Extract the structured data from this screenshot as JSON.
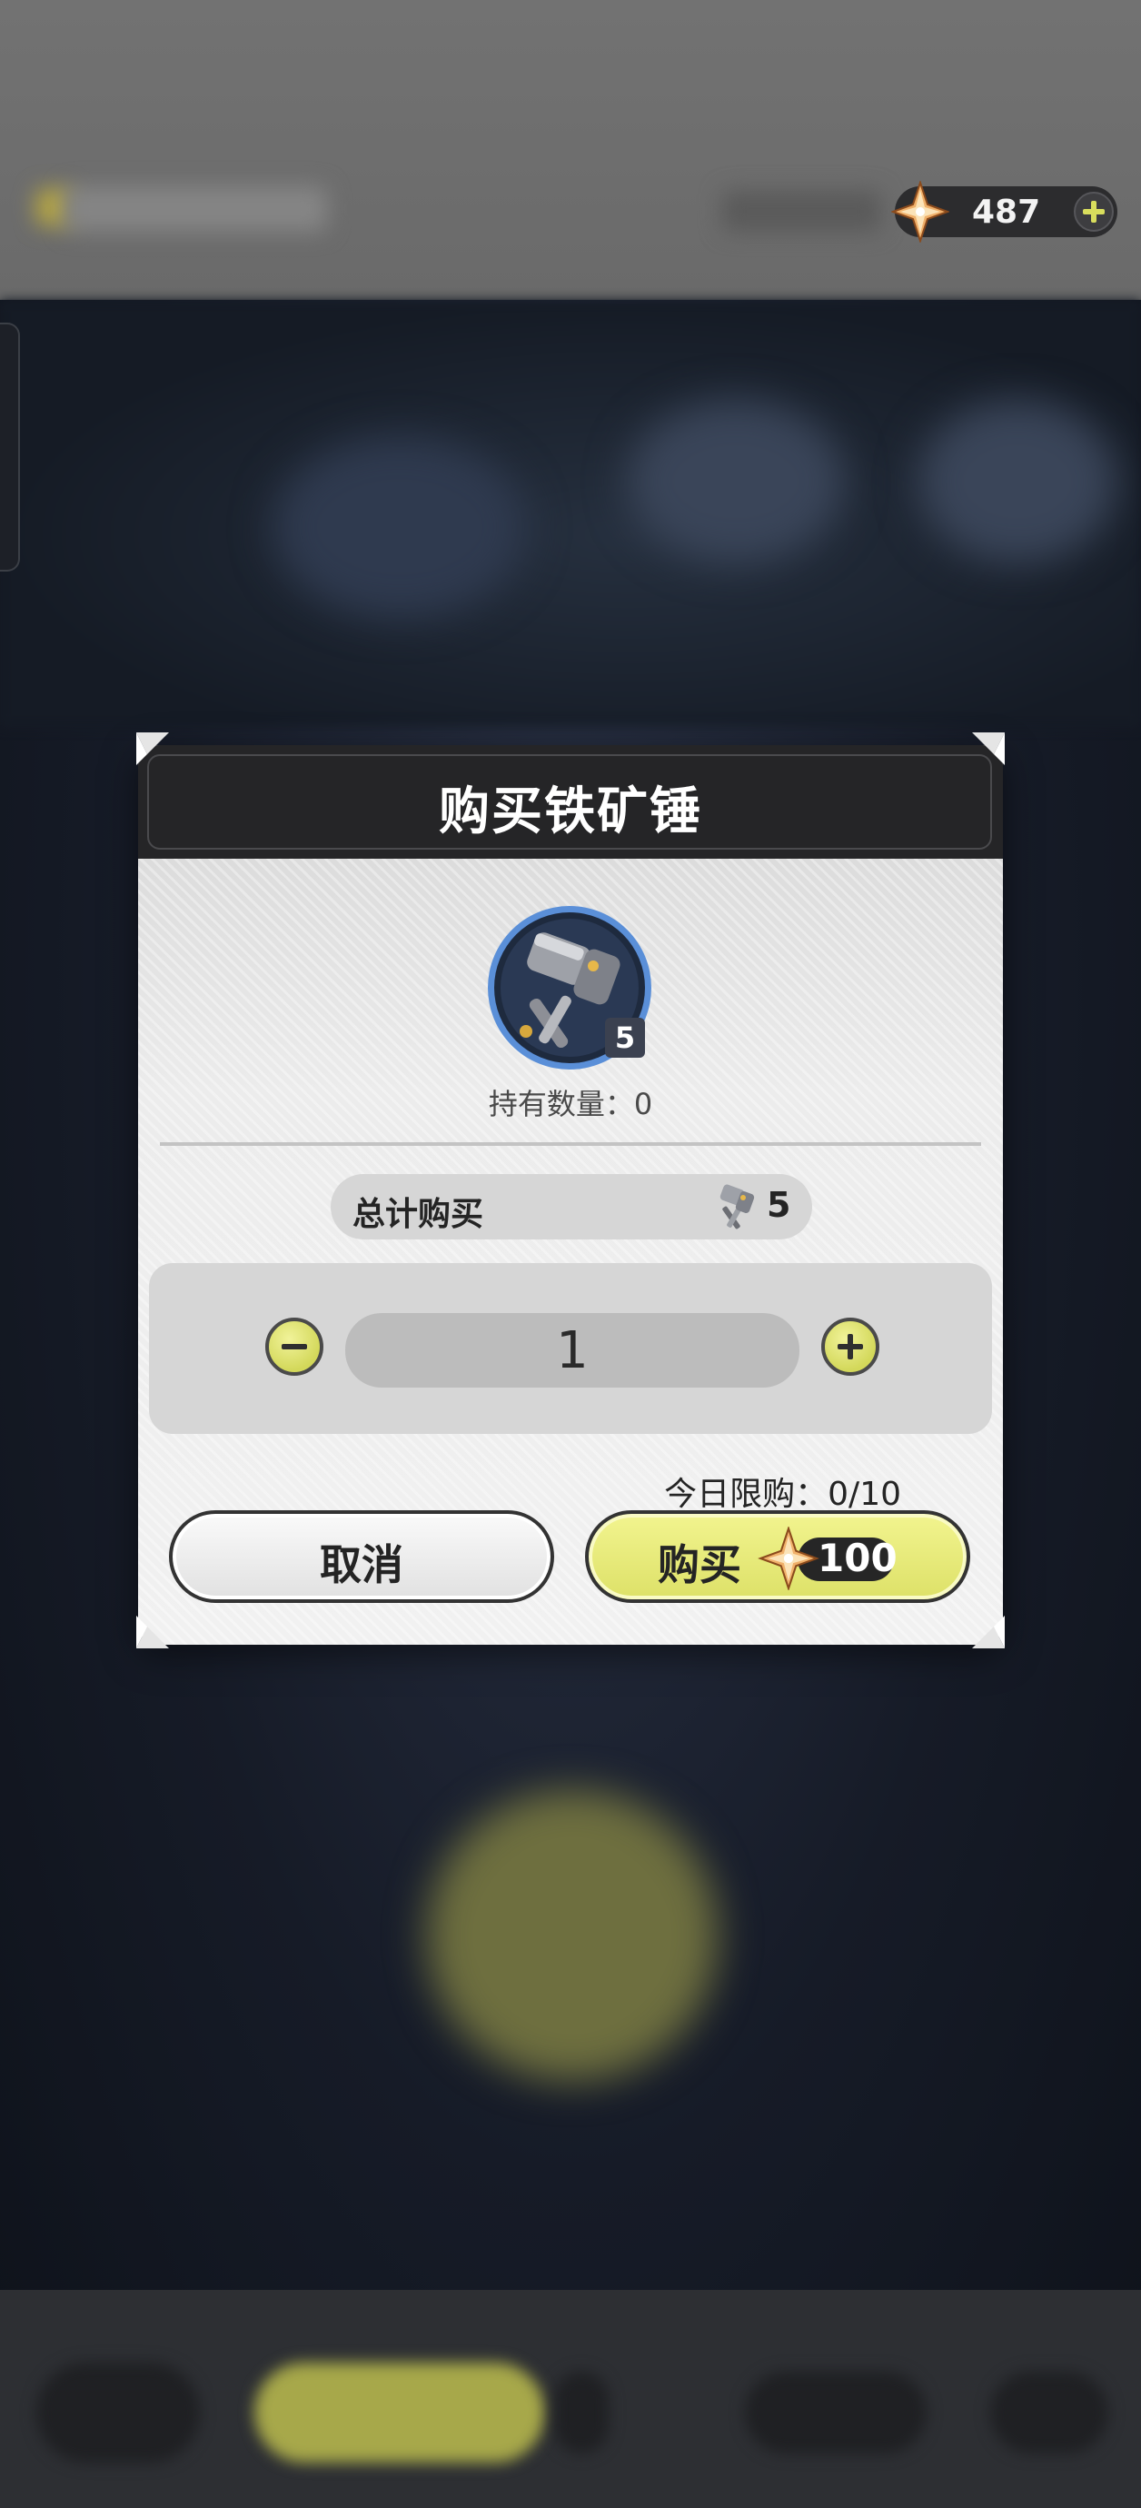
{
  "header": {
    "currency": {
      "icon": "star-crystal-icon",
      "amount": "487"
    }
  },
  "dialog": {
    "title": "购买铁矿锤",
    "item": {
      "icon": "iron-hammer-icon",
      "badge": "5",
      "owned": "持有数量：0"
    },
    "total": {
      "label": "总计购买",
      "icon": "iron-hammer-icon",
      "value": "5"
    },
    "quantity": {
      "value": "1",
      "decrease_icon": "minus-icon",
      "increase_icon": "plus-icon"
    },
    "daily_limit": "今日限购：0/10",
    "cancel_label": "取消",
    "buy": {
      "label": "购买",
      "icon": "star-crystal-icon",
      "price": "100"
    }
  },
  "colors": {
    "accent": "#dde168",
    "dialog_header": "#252527",
    "dialog_body": "#e9e9e9"
  }
}
